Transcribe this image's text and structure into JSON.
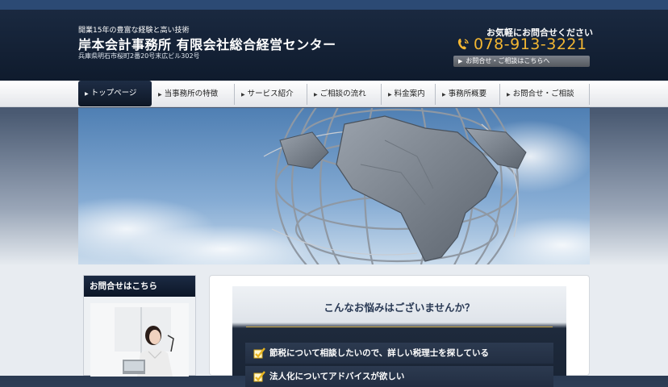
{
  "header": {
    "tagline": "開業15年の豊富な経験と高い技術",
    "title": "岸本会計事務所 有限会社総合経営センター",
    "address": "兵庫県明石市桜町2番20号末広ビル302号",
    "contact_label": "お気軽にお問合せください",
    "phone": "078-913-3221",
    "contact_link": "お問合せ・ご相談はこちらへ"
  },
  "nav": {
    "items": [
      {
        "label": "トップページ"
      },
      {
        "label": "当事務所の特徴"
      },
      {
        "label": "サービス紹介"
      },
      {
        "label": "ご相談の流れ"
      },
      {
        "label": "料金案内"
      },
      {
        "label": "事務所概要"
      },
      {
        "label": "お問合せ・ご相談"
      }
    ]
  },
  "sidebar": {
    "heading": "お問合せはこちら"
  },
  "main": {
    "worry_title": "こんなお悩みはございませんか？",
    "worries": [
      "節税について相談したいので、詳しい税理士を探している",
      "法人化についてアドバイスが欲しい"
    ]
  },
  "colors": {
    "navy": "#0f1b2d",
    "phone_orange": "#f2b632",
    "gold_line": "#c9a440"
  }
}
